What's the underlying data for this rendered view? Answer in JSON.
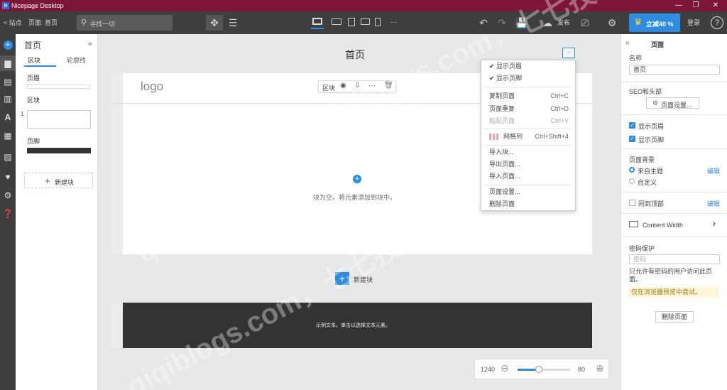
{
  "window": {
    "app_title": "Nicepage Desktop",
    "min": "—",
    "restore": "❐",
    "close": "✕"
  },
  "toolbar": {
    "site_back": "< 站点",
    "breadcrumb": "页面: 首页",
    "search_placeholder": "寻找一切",
    "publish_label": "发布",
    "upgrade_label": "立减40 %",
    "login_label": "登录",
    "help": "?"
  },
  "left_panel": {
    "title": "首页",
    "tab_blocks": "区块",
    "tab_outline": "轮廓线",
    "header_label": "页眉",
    "blocks_label": "区块",
    "block_number": "1",
    "footer_label": "页脚",
    "new_block": "新建块"
  },
  "canvas": {
    "page_title": "首页",
    "logo": "logo",
    "block_toolbar_label": "区块",
    "empty_message": "块为空。将元素添加到块中。",
    "new_block_label": "新建块",
    "footer_text": "示例文本。单击以选择文本元素。"
  },
  "menu": {
    "show_header": "显示页眉",
    "show_footer": "显示页脚",
    "copy_page": "复制页面",
    "copy_page_shortcut": "Ctrl+C",
    "duplicate_page": "页面重复",
    "duplicate_page_shortcut": "Ctrl+D",
    "paste_page": "粘贴页面",
    "paste_page_shortcut": "Ctrl+V",
    "grid_columns": "网格列",
    "grid_columns_shortcut": "Ctrl+Shift+4",
    "import_block": "导入块...",
    "export_page": "导出页面...",
    "import_page": "导入页面...",
    "page_settings": "页面设置...",
    "delete_page": "删除页面"
  },
  "right_panel": {
    "title": "页面",
    "name_label": "名称",
    "name_value": "首页",
    "seo_label": "SEO和头部",
    "page_settings_button": "页面设置...",
    "show_header": "显示页眉",
    "show_footer": "显示页脚",
    "background_label": "页面背景",
    "from_theme": "来自主题",
    "custom": "自定义",
    "edit": "编辑",
    "same_top": "同到顶部",
    "edit2": "编辑",
    "content_width": "Content Width",
    "password_label": "密码保护",
    "password_placeholder": "密码",
    "password_hint": "只允许有密码的用户访问此页面。",
    "preview_note": "仅在浏览器预览中尝试。",
    "delete_page_button": "删除页面"
  },
  "zoom": {
    "width_value": "1240",
    "zoom_value": "80",
    "zoom_level": 0.4
  },
  "watermark": {
    "text1": "qiqiblogs.com，七七技术，",
    "text2": "qiqiblogs.com，七七技术，",
    "text3": "qiqiblogs.com，七七技术，"
  },
  "colors": {
    "accent": "#2e8de0",
    "titlebar": "#7d1538",
    "toolbar": "#3e3e3e"
  }
}
